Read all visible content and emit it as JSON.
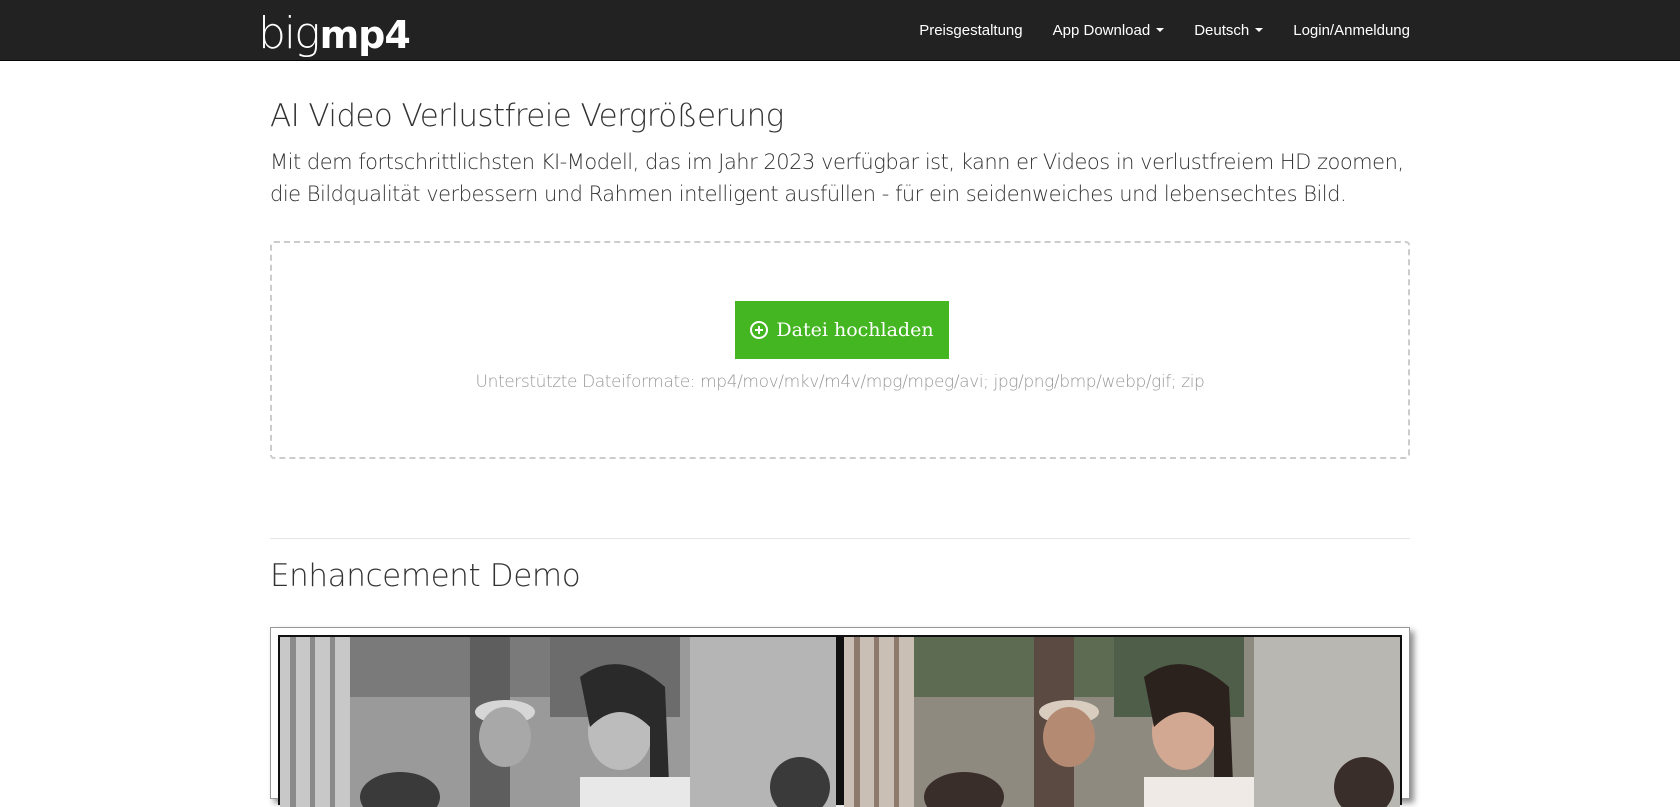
{
  "header": {
    "logo": {
      "big": "big",
      "mp4": "mp4"
    },
    "nav": [
      {
        "label": "Preisgestaltung",
        "dropdown": false
      },
      {
        "label": "App Download",
        "dropdown": true
      },
      {
        "label": "Deutsch",
        "dropdown": true
      },
      {
        "label": "Login/Anmeldung",
        "dropdown": false
      }
    ]
  },
  "main": {
    "title": "AI Video Verlustfreie Vergrößerung",
    "description": "Mit dem fortschrittlichsten KI-Modell, das im Jahr 2023 verfügbar ist, kann er Videos in verlustfreiem HD zoomen, die Bildqualität verbessern und Rahmen intelligent ausfüllen - für ein seidenweiches und lebensechtes Bild.",
    "upload": {
      "button_label": "Datei hochladen",
      "button_icon": "plus-circle-icon",
      "formats": "Unterstützte Dateiformate: mp4/mov/mkv/m4v/mpg/mpeg/avi; jpg/png/bmp/webp/gif; zip"
    },
    "demo": {
      "title": "Enhancement Demo"
    }
  },
  "colors": {
    "navbar_bg": "#222222",
    "accent_green": "#44b622"
  }
}
